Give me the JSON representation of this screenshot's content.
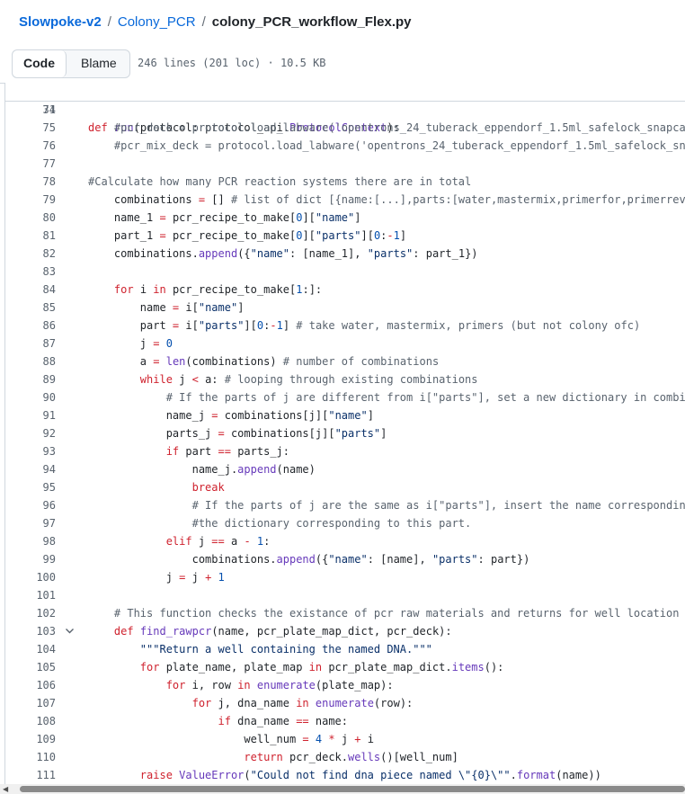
{
  "breadcrumb": {
    "repo": "Slowpoke-v2",
    "sep": "/",
    "folder": "Colony_PCR",
    "file": "colony_PCR_workflow_Flex.py"
  },
  "toolbar": {
    "code_tab": "Code",
    "blame_tab": "Blame",
    "file_info": "246 lines (201 loc) · 10.5 KB"
  },
  "sticky_line": {
    "num": "31",
    "code": "def run(protocol: protocol_api.ProtocolContext):"
  },
  "lines": [
    {
      "num": "74",
      "code": ""
    },
    {
      "num": "75",
      "code": "    #pcr_deck = protocol.load_labware('opentrons_24_tuberack_eppendorf_1.5ml_safelock_snapcap"
    },
    {
      "num": "76",
      "code": "    #pcr_mix_deck = protocol.load_labware('opentrons_24_tuberack_eppendorf_1.5ml_safelock_sna"
    },
    {
      "num": "77",
      "code": ""
    },
    {
      "num": "78",
      "code": "#Calculate how many PCR reaction systems there are in total"
    },
    {
      "num": "79",
      "code": "    combinations = [] # list of dict [{name:[...],parts:[water,mastermix,primerfor,primerrev]"
    },
    {
      "num": "80",
      "code": "    name_1 = pcr_recipe_to_make[0][\"name\"]"
    },
    {
      "num": "81",
      "code": "    part_1 = pcr_recipe_to_make[0][\"parts\"][0:-1]"
    },
    {
      "num": "82",
      "code": "    combinations.append({\"name\": [name_1], \"parts\": part_1})"
    },
    {
      "num": "83",
      "code": ""
    },
    {
      "num": "84",
      "code": "    for i in pcr_recipe_to_make[1:]:"
    },
    {
      "num": "85",
      "code": "        name = i[\"name\"]"
    },
    {
      "num": "86",
      "code": "        part = i[\"parts\"][0:-1] # take water, mastermix, primers (but not colony ofc)"
    },
    {
      "num": "87",
      "code": "        j = 0"
    },
    {
      "num": "88",
      "code": "        a = len(combinations) # number of combinations"
    },
    {
      "num": "89",
      "code": "        while j < a: # looping through existing combinations"
    },
    {
      "num": "90",
      "code": "            # If the parts of j are different from i[\"parts\"], set a new dictionary in combin"
    },
    {
      "num": "91",
      "code": "            name_j = combinations[j][\"name\"]"
    },
    {
      "num": "92",
      "code": "            parts_j = combinations[j][\"parts\"]"
    },
    {
      "num": "93",
      "code": "            if part == parts_j:"
    },
    {
      "num": "94",
      "code": "                name_j.append(name)"
    },
    {
      "num": "95",
      "code": "                break"
    },
    {
      "num": "96",
      "code": "                # If the parts of j are the same as i[\"parts\"], insert the name corresponding"
    },
    {
      "num": "97",
      "code": "                #the dictionary corresponding to this part."
    },
    {
      "num": "98",
      "code": "            elif j == a - 1:"
    },
    {
      "num": "99",
      "code": "                combinations.append({\"name\": [name], \"parts\": part})"
    },
    {
      "num": "100",
      "code": "            j = j + 1"
    },
    {
      "num": "101",
      "code": ""
    },
    {
      "num": "102",
      "code": "    # This function checks the existance of pcr raw materials and returns for well location o"
    },
    {
      "num": "103",
      "code": "    def find_rawpcr(name, pcr_plate_map_dict, pcr_deck):"
    },
    {
      "num": "104",
      "code": "        \"\"\"Return a well containing the named DNA.\"\"\""
    },
    {
      "num": "105",
      "code": "        for plate_name, plate_map in pcr_plate_map_dict.items():"
    },
    {
      "num": "106",
      "code": "            for i, row in enumerate(plate_map):"
    },
    {
      "num": "107",
      "code": "                for j, dna_name in enumerate(row):"
    },
    {
      "num": "108",
      "code": "                    if dna_name == name:"
    },
    {
      "num": "109",
      "code": "                        well_num = 4 * j + i"
    },
    {
      "num": "110",
      "code": "                        return pcr_deck.wells()[well_num]"
    },
    {
      "num": "111",
      "code": "        raise ValueError(\"Could not find dna piece named \\\"{0}\\\"\".format(name))"
    }
  ],
  "colors": {
    "link": "#0969da",
    "keyword": "#cf222e",
    "function": "#6639ba",
    "string": "#0a3069",
    "comment": "#59636e",
    "number": "#0550ae"
  },
  "icons": {
    "fold": "chevron-down-icon",
    "scroll_left": "arrow-left-icon"
  }
}
